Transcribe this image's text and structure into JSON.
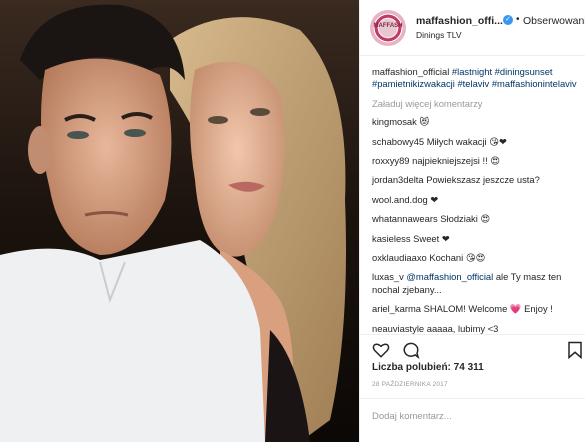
{
  "header": {
    "username": "maffashion_offi...",
    "follow_label": "Obserwowani",
    "location": "Dinings TLV",
    "avatar_text": "MAFFASH"
  },
  "caption": {
    "username": "maffashion_official",
    "hashtags": "#lastnight #diningsunset #pamietnikizwakacji #telaviv #maffashionintelaviv"
  },
  "load_more": "Załaduj więcej komentarzy",
  "comments": [
    {
      "user": "kingmosak",
      "text": "😻"
    },
    {
      "user": "schabowy45",
      "text": "Miłych wakacji 😘❤"
    },
    {
      "user": "roxxyy89",
      "text": "najpiekniejszejsi !! 😍"
    },
    {
      "user": "jordan3delta",
      "text": "Powiekszasz jeszcze usta?"
    },
    {
      "user": "wool.and.dog",
      "text": "❤"
    },
    {
      "user": "whatannawears",
      "text": "Słodziaki 😍"
    },
    {
      "user": "kasieless",
      "text": "Sweet ❤"
    },
    {
      "user": "oxklaudiaaxo",
      "text": "Kochani 😘😍"
    },
    {
      "user": "luxas_v",
      "mention": "@maffashion_official",
      "text": "ale Ty masz ten nochal zjebany..."
    },
    {
      "user": "ariel_karma",
      "text": "SHALOM! Welcome 💗 Enjoy !"
    },
    {
      "user": "neauviastyle",
      "text": "aaaaa, lubimy <3"
    }
  ],
  "likes": "Liczba polubień: 74 311",
  "date": "28 PAŹDZIERNIKA 2017",
  "add_comment_placeholder": "Dodaj komentarz..."
}
